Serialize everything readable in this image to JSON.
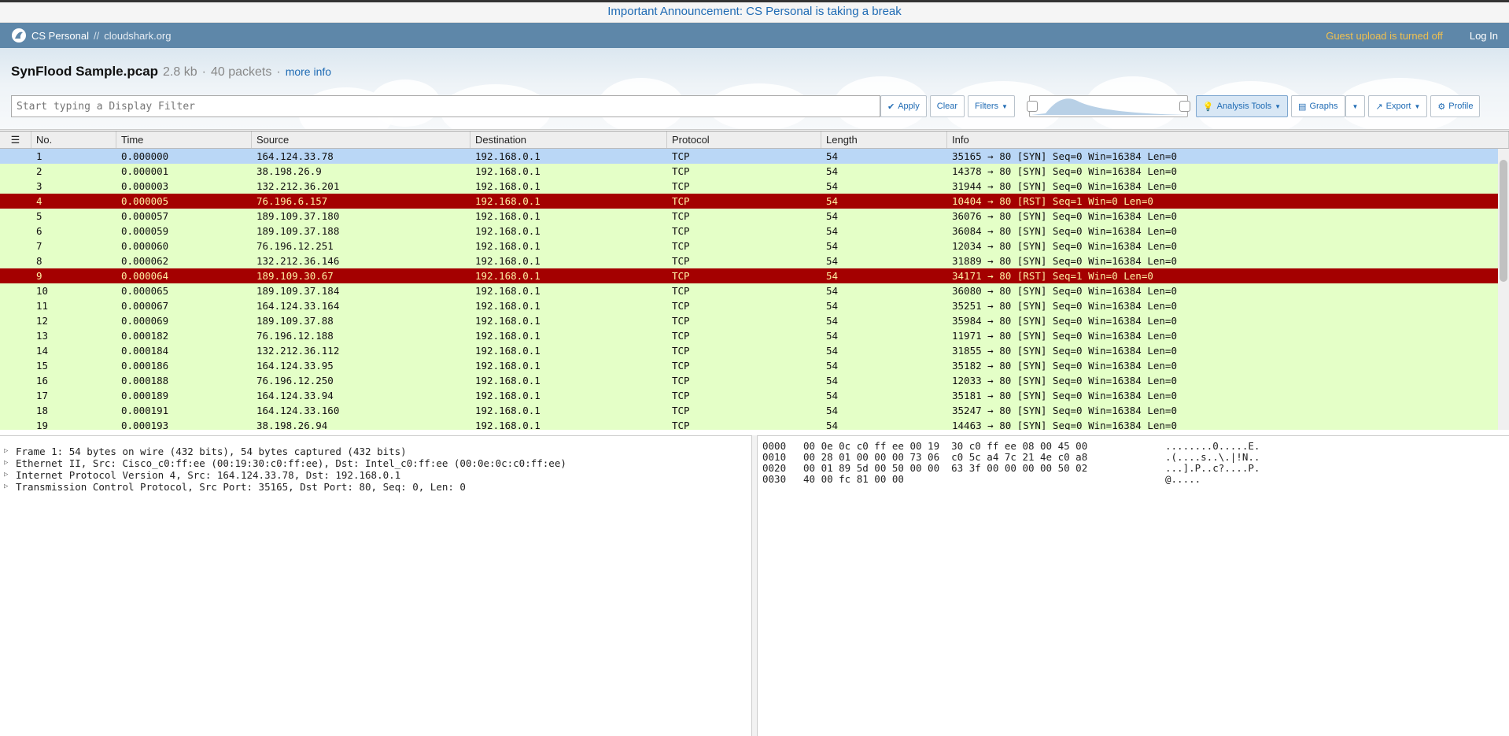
{
  "announcement": "Important Announcement: CS Personal is taking a break",
  "nav": {
    "brand": "CS Personal",
    "separator": "//",
    "site": "cloudshark.org",
    "guest_notice": "Guest upload is turned off",
    "login": "Log In"
  },
  "file": {
    "name": "SynFlood Sample.pcap",
    "size": "2.8 kb",
    "packets": "40 packets",
    "dot": "·",
    "more_info": "more info"
  },
  "toolbar": {
    "filter_placeholder": "Start typing a Display Filter",
    "apply": "Apply",
    "clear": "Clear",
    "filters": "Filters",
    "analysis_tools": "Analysis Tools",
    "graphs": "Graphs",
    "export": "Export",
    "profile": "Profile"
  },
  "columns": [
    "No.",
    "Time",
    "Source",
    "Destination",
    "Protocol",
    "Length",
    "Info"
  ],
  "rows": [
    {
      "no": "1",
      "time": "0.000000",
      "src": "164.124.33.78",
      "dst": "192.168.0.1",
      "proto": "TCP",
      "len": "54",
      "info": "35165 → 80 [SYN] Seq=0 Win=16384 Len=0",
      "style": "sel"
    },
    {
      "no": "2",
      "time": "0.000001",
      "src": "38.198.26.9",
      "dst": "192.168.0.1",
      "proto": "TCP",
      "len": "54",
      "info": "14378 → 80 [SYN] Seq=0 Win=16384 Len=0",
      "style": "syn"
    },
    {
      "no": "3",
      "time": "0.000003",
      "src": "132.212.36.201",
      "dst": "192.168.0.1",
      "proto": "TCP",
      "len": "54",
      "info": "31944 → 80 [SYN] Seq=0 Win=16384 Len=0",
      "style": "syn"
    },
    {
      "no": "4",
      "time": "0.000005",
      "src": "76.196.6.157",
      "dst": "192.168.0.1",
      "proto": "TCP",
      "len": "54",
      "info": "10404 → 80 [RST] Seq=1 Win=0 Len=0",
      "style": "rst"
    },
    {
      "no": "5",
      "time": "0.000057",
      "src": "189.109.37.180",
      "dst": "192.168.0.1",
      "proto": "TCP",
      "len": "54",
      "info": "36076 → 80 [SYN] Seq=0 Win=16384 Len=0",
      "style": "syn"
    },
    {
      "no": "6",
      "time": "0.000059",
      "src": "189.109.37.188",
      "dst": "192.168.0.1",
      "proto": "TCP",
      "len": "54",
      "info": "36084 → 80 [SYN] Seq=0 Win=16384 Len=0",
      "style": "syn"
    },
    {
      "no": "7",
      "time": "0.000060",
      "src": "76.196.12.251",
      "dst": "192.168.0.1",
      "proto": "TCP",
      "len": "54",
      "info": "12034 → 80 [SYN] Seq=0 Win=16384 Len=0",
      "style": "syn"
    },
    {
      "no": "8",
      "time": "0.000062",
      "src": "132.212.36.146",
      "dst": "192.168.0.1",
      "proto": "TCP",
      "len": "54",
      "info": "31889 → 80 [SYN] Seq=0 Win=16384 Len=0",
      "style": "syn"
    },
    {
      "no": "9",
      "time": "0.000064",
      "src": "189.109.30.67",
      "dst": "192.168.0.1",
      "proto": "TCP",
      "len": "54",
      "info": "34171 → 80 [RST] Seq=1 Win=0 Len=0",
      "style": "rst"
    },
    {
      "no": "10",
      "time": "0.000065",
      "src": "189.109.37.184",
      "dst": "192.168.0.1",
      "proto": "TCP",
      "len": "54",
      "info": "36080 → 80 [SYN] Seq=0 Win=16384 Len=0",
      "style": "syn"
    },
    {
      "no": "11",
      "time": "0.000067",
      "src": "164.124.33.164",
      "dst": "192.168.0.1",
      "proto": "TCP",
      "len": "54",
      "info": "35251 → 80 [SYN] Seq=0 Win=16384 Len=0",
      "style": "syn"
    },
    {
      "no": "12",
      "time": "0.000069",
      "src": "189.109.37.88",
      "dst": "192.168.0.1",
      "proto": "TCP",
      "len": "54",
      "info": "35984 → 80 [SYN] Seq=0 Win=16384 Len=0",
      "style": "syn"
    },
    {
      "no": "13",
      "time": "0.000182",
      "src": "76.196.12.188",
      "dst": "192.168.0.1",
      "proto": "TCP",
      "len": "54",
      "info": "11971 → 80 [SYN] Seq=0 Win=16384 Len=0",
      "style": "syn"
    },
    {
      "no": "14",
      "time": "0.000184",
      "src": "132.212.36.112",
      "dst": "192.168.0.1",
      "proto": "TCP",
      "len": "54",
      "info": "31855 → 80 [SYN] Seq=0 Win=16384 Len=0",
      "style": "syn"
    },
    {
      "no": "15",
      "time": "0.000186",
      "src": "164.124.33.95",
      "dst": "192.168.0.1",
      "proto": "TCP",
      "len": "54",
      "info": "35182 → 80 [SYN] Seq=0 Win=16384 Len=0",
      "style": "syn"
    },
    {
      "no": "16",
      "time": "0.000188",
      "src": "76.196.12.250",
      "dst": "192.168.0.1",
      "proto": "TCP",
      "len": "54",
      "info": "12033 → 80 [SYN] Seq=0 Win=16384 Len=0",
      "style": "syn"
    },
    {
      "no": "17",
      "time": "0.000189",
      "src": "164.124.33.94",
      "dst": "192.168.0.1",
      "proto": "TCP",
      "len": "54",
      "info": "35181 → 80 [SYN] Seq=0 Win=16384 Len=0",
      "style": "syn"
    },
    {
      "no": "18",
      "time": "0.000191",
      "src": "164.124.33.160",
      "dst": "192.168.0.1",
      "proto": "TCP",
      "len": "54",
      "info": "35247 → 80 [SYN] Seq=0 Win=16384 Len=0",
      "style": "syn"
    },
    {
      "no": "19",
      "time": "0.000193",
      "src": "38.198.26.94",
      "dst": "192.168.0.1",
      "proto": "TCP",
      "len": "54",
      "info": "14463 → 80 [SYN] Seq=0 Win=16384 Len=0",
      "style": "syn"
    }
  ],
  "tree": [
    "Frame 1: 54 bytes on wire (432 bits), 54 bytes captured (432 bits)",
    "Ethernet II, Src: Cisco_c0:ff:ee (00:19:30:c0:ff:ee), Dst: Intel_c0:ff:ee (00:0e:0c:c0:ff:ee)",
    "Internet Protocol Version 4, Src: 164.124.33.78, Dst: 192.168.0.1",
    "Transmission Control Protocol, Src Port: 35165, Dst Port: 80, Seq: 0, Len: 0"
  ],
  "hex": [
    {
      "offset": "0000",
      "bytes": "00 0e 0c c0 ff ee 00 19  30 c0 ff ee 08 00 45 00",
      "ascii": "........0.....E."
    },
    {
      "offset": "0010",
      "bytes": "00 28 01 00 00 00 73 06  c0 5c a4 7c 21 4e c0 a8",
      "ascii": ".(....s..\\.|!N.."
    },
    {
      "offset": "0020",
      "bytes": "00 01 89 5d 00 50 00 00  63 3f 00 00 00 00 50 02",
      "ascii": "...].P..c?....P."
    },
    {
      "offset": "0030",
      "bytes": "40 00 fc 81 00 00",
      "ascii": "@....."
    }
  ]
}
